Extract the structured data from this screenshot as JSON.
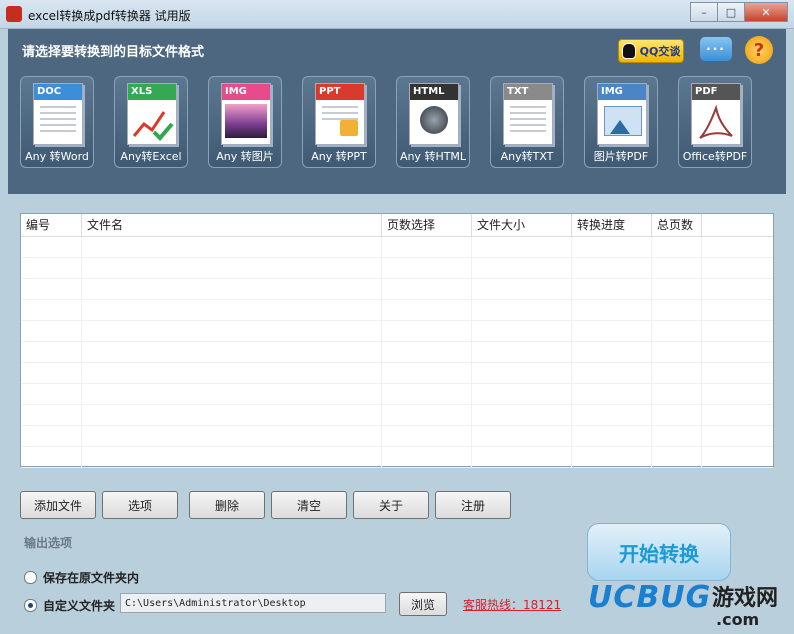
{
  "window": {
    "title": "excel转换成pdf转换器 试用版",
    "controls": [
      "–",
      "□",
      "✕"
    ]
  },
  "header": {
    "prompt": "请选择要转换到的目标文件格式",
    "qq_label": "QQ交谈",
    "chat_icon": "chat-bubble-icon",
    "help_symbol": "?"
  },
  "formats": [
    {
      "tag": "DOC",
      "label": "Any 转Word",
      "color": "#3a8fd8"
    },
    {
      "tag": "XLS",
      "label": "Any转Excel",
      "color": "#34a853"
    },
    {
      "tag": "IMG",
      "label": "Any 转图片",
      "color": "#e64b8a"
    },
    {
      "tag": "PPT",
      "label": "Any 转PPT",
      "color": "#d93a2b"
    },
    {
      "tag": "HTML",
      "label": "Any 转HTML",
      "color": "#333333"
    },
    {
      "tag": "TXT",
      "label": "Any转TXT",
      "color": "#8a8a8a"
    },
    {
      "tag": "IMG",
      "label": "图片转PDF",
      "color": "#4a86c5"
    },
    {
      "tag": "PDF",
      "label": "Office转PDF",
      "color": "#555555"
    }
  ],
  "table": {
    "columns": [
      "编号",
      "文件名",
      "页数选择",
      "文件大小",
      "转换进度",
      "总页数"
    ],
    "rows": []
  },
  "buttons": {
    "add_file": "添加文件",
    "options": "选项",
    "delete": "删除",
    "clear": "清空",
    "about": "关于",
    "register": "注册"
  },
  "output": {
    "section_title": "输出选项",
    "option_original": "保存在原文件夹内",
    "option_custom": "自定义文件夹",
    "path": "C:\\Users\\Administrator\\Desktop",
    "browse": "浏览",
    "selected": "custom"
  },
  "start_button": "开始转换",
  "hotline": "客服热线：18121",
  "watermark": {
    "brand": "UCBUG",
    "site": "游戏网",
    "com": ".com"
  }
}
